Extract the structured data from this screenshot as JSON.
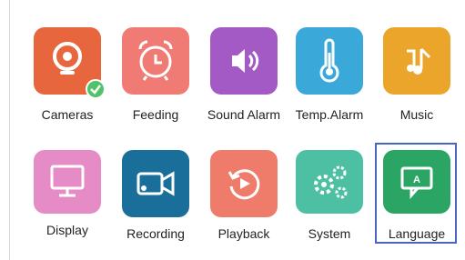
{
  "menu": {
    "row1": [
      {
        "id": "cameras",
        "label": "Cameras",
        "icon": "camera-icon",
        "color": "#e8663d",
        "badge": "checkmark-icon"
      },
      {
        "id": "feeding",
        "label": "Feeding",
        "icon": "alarm-clock-icon",
        "color": "#ef7b74"
      },
      {
        "id": "sound-alarm",
        "label": "Sound Alarm",
        "icon": "speaker-icon",
        "color": "#a45ac4"
      },
      {
        "id": "temp-alarm",
        "label": "Temp.Alarm",
        "icon": "thermometer-icon",
        "color": "#3aa9d9"
      },
      {
        "id": "music",
        "label": "Music",
        "icon": "music-note-icon",
        "color": "#eaa52a"
      }
    ],
    "row2": [
      {
        "id": "display",
        "label": "Display",
        "icon": "monitor-icon",
        "color": "#e58cc6"
      },
      {
        "id": "recording",
        "label": "Recording",
        "icon": "video-camera-icon",
        "color": "#1a6f9a"
      },
      {
        "id": "playback",
        "label": "Playback",
        "icon": "replay-icon",
        "color": "#ef7b6a"
      },
      {
        "id": "system",
        "label": "System",
        "icon": "gears-icon",
        "color": "#4dc0a3"
      },
      {
        "id": "language",
        "label": "Language",
        "icon": "language-icon",
        "color": "#2aa564",
        "selected": true
      }
    ]
  }
}
